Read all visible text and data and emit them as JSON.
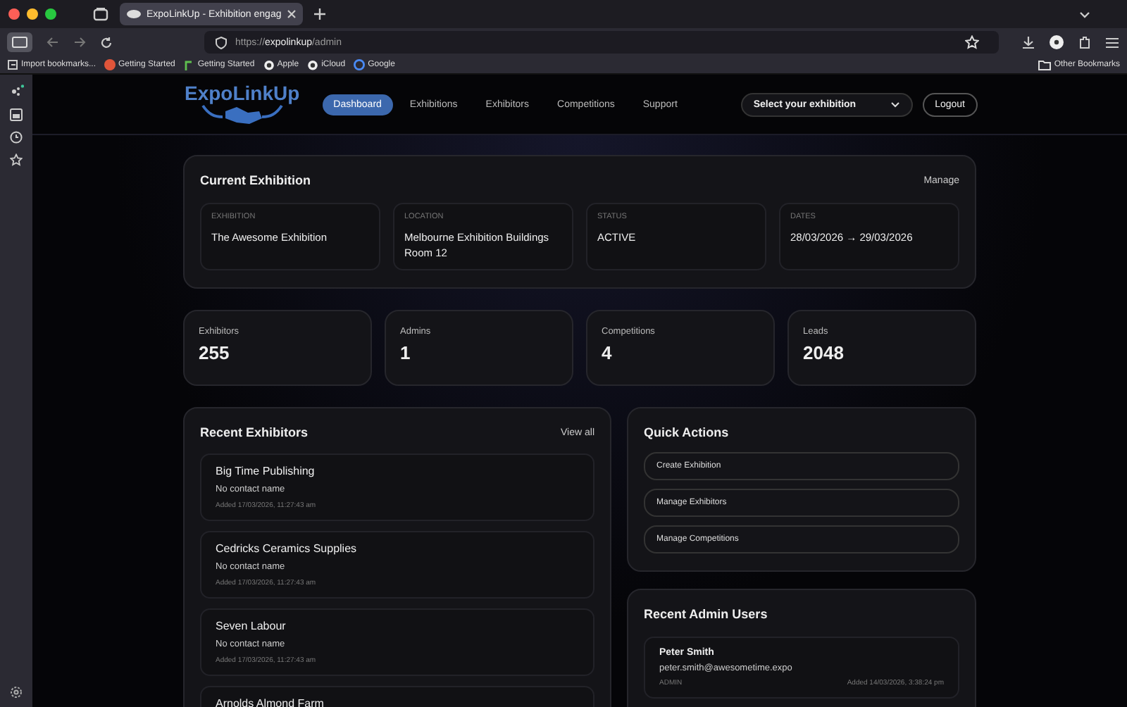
{
  "browser": {
    "tabs": [
      {
        "title": "ExpoLinkUp - Exhibition engag",
        "selected": true
      }
    ],
    "url_prefix": "https://",
    "url_host": "expolinkup",
    "url_path": "/admin",
    "bookmarks": [
      {
        "label": "Import bookmarks...",
        "kind": "import"
      },
      {
        "label": "Getting Started",
        "kind": "fire"
      },
      {
        "label": "Getting Started",
        "kind": "leaf"
      },
      {
        "label": "Apple",
        "kind": "apple"
      },
      {
        "label": "iCloud",
        "kind": "apple"
      },
      {
        "label": "Google",
        "kind": "google"
      }
    ],
    "other_bookmarks": "Other Bookmarks"
  },
  "header": {
    "logo": "ExpoLinkUp",
    "nav": [
      {
        "label": "Dashboard",
        "selected": true
      },
      {
        "label": "Exhibitions",
        "selected": false
      },
      {
        "label": "Exhibitors",
        "selected": false
      },
      {
        "label": "Competitions",
        "selected": false
      },
      {
        "label": "Support",
        "selected": false
      }
    ],
    "exhibition_select": "Select your exhibition",
    "logout": "Logout"
  },
  "current_exhibition": {
    "title": "Current Exhibition",
    "action": "Manage",
    "fields": [
      {
        "label": "EXHIBITION",
        "value": "The Awesome Exhibition"
      },
      {
        "label": "LOCATION",
        "value": "Melbourne Exhibition Buildings Room 12"
      },
      {
        "label": "STATUS",
        "value": "ACTIVE"
      },
      {
        "label": "DATES",
        "value": "28/03/2026 → 29/03/2026"
      }
    ]
  },
  "stats": [
    {
      "label": "Exhibitors",
      "value": "255"
    },
    {
      "label": "Admins",
      "value": "1"
    },
    {
      "label": "Competitions",
      "value": "4"
    },
    {
      "label": "Leads",
      "value": "2048"
    }
  ],
  "recent_exhibitors": {
    "title": "Recent Exhibitors",
    "action": "View all",
    "items": [
      {
        "name": "Big Time Publishing",
        "contact": "No contact name",
        "added": "Added 17/03/2026, 11:27:43 am"
      },
      {
        "name": "Cedricks Ceramics Supplies",
        "contact": "No contact name",
        "added": "Added 17/03/2026, 11:27:43 am"
      },
      {
        "name": "Seven Labour",
        "contact": "No contact name",
        "added": "Added 17/03/2026, 11:27:43 am"
      },
      {
        "name": "Arnolds Almond Farm"
      }
    ]
  },
  "quick_actions": {
    "title": "Quick Actions",
    "buttons": [
      "Create Exhibition",
      "Manage Exhibitors",
      "Manage Competitions"
    ]
  },
  "recent_admins": {
    "title": "Recent Admin Users",
    "items": [
      {
        "name": "Peter Smith",
        "email": "peter.smith@awesometime.expo",
        "role": "ADMIN",
        "added": "Added 14/03/2026, 3:38:24 pm"
      }
    ]
  }
}
